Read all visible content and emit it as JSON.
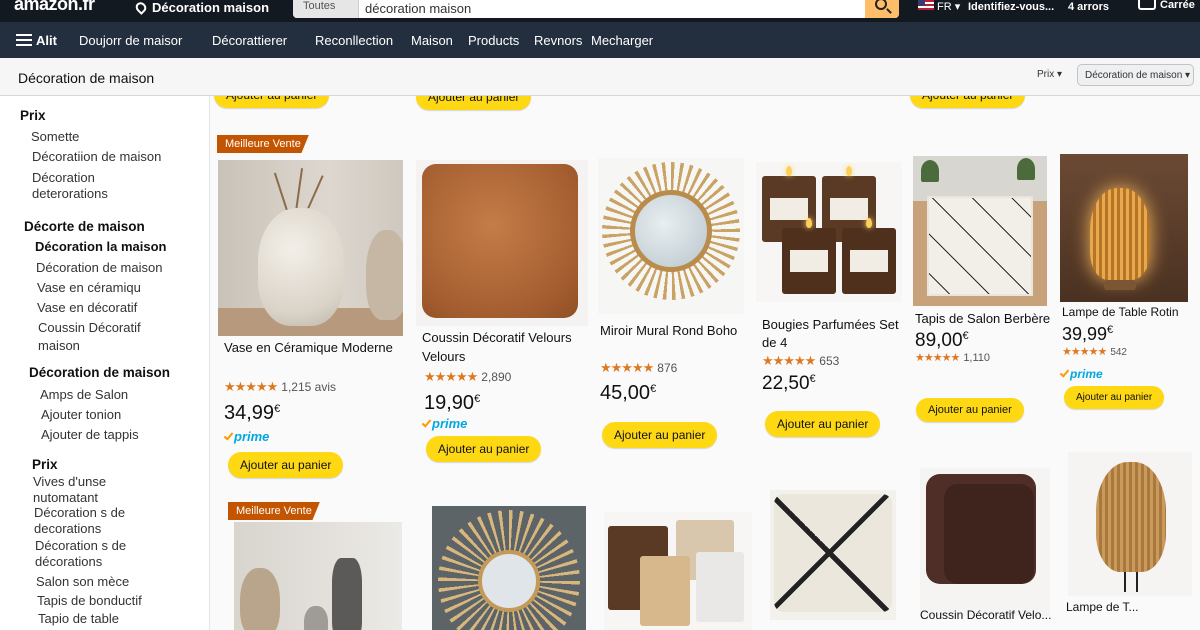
{
  "header": {
    "logo": "amazon.fr",
    "location": "Décoration maison",
    "search_category": "Toutes",
    "search_value": "décoration maison",
    "lang": "FR",
    "account": "Identifiez-vous...",
    "orders": "4 arrors",
    "cart": "Carrée"
  },
  "nav": {
    "all": "Alit",
    "items": [
      "Doujorr de maisor",
      "Décorattierer",
      "Reconllection",
      "Maison",
      "Products",
      "Revnors",
      "Mecharger"
    ]
  },
  "subheader": {
    "title": "Décoration de maison",
    "sort_label": "Prix",
    "sort_value": "Décoration de maison"
  },
  "sidebar": [
    {
      "text": "Prix",
      "style": "head"
    },
    {
      "text": "Somette",
      "style": "item"
    },
    {
      "text": "Décoratiion de maison",
      "style": "item"
    },
    {
      "text": "Décoration",
      "style": "item"
    },
    {
      "text": "deterorations",
      "style": "item"
    },
    {
      "text": "Décorte de maison",
      "style": "head"
    },
    {
      "text": "Décoration la maison",
      "style": "strong"
    },
    {
      "text": "Décoration de maison",
      "style": "item"
    },
    {
      "text": "Vase en céramiqu",
      "style": "item"
    },
    {
      "text": "Vase en décoratif",
      "style": "item"
    },
    {
      "text": "Coussin Décoratif",
      "style": "item"
    },
    {
      "text": "maison",
      "style": "item"
    },
    {
      "text": "Décoration de maison",
      "style": "head"
    },
    {
      "text": "Amps de Salon",
      "style": "item"
    },
    {
      "text": "Ajouter tonion",
      "style": "item"
    },
    {
      "text": "Ajouter de tappis",
      "style": "item"
    },
    {
      "text": "Prix",
      "style": "head"
    },
    {
      "text": "Vives d'unse",
      "style": "item"
    },
    {
      "text": "nutomatant",
      "style": "item"
    },
    {
      "text": "Décoration s de",
      "style": "item"
    },
    {
      "text": "decorations",
      "style": "item"
    },
    {
      "text": "Décoration s de",
      "style": "item"
    },
    {
      "text": "décorations",
      "style": "item"
    },
    {
      "text": "Salon son mèce",
      "style": "item"
    },
    {
      "text": "Tapis de bonductif",
      "style": "item"
    },
    {
      "text": "Tapio de table",
      "style": "item"
    }
  ],
  "add_to_cart": "Ajouter au panier",
  "bestseller": "Meilleure Vente",
  "prime": "prime",
  "products": [
    {
      "title": "Vase en Céramique Moderne",
      "stars": "★★★★★",
      "reviews": "1,215 avis",
      "price": "34,99",
      "currency": "€",
      "prime": true
    },
    {
      "title": "Coussin Décoratif Velours Velours",
      "stars": "★★★★★",
      "reviews": "2,890",
      "price": "19,90",
      "currency": "€",
      "prime": true
    },
    {
      "title": "Miroir Mural Rond Boho",
      "stars": "★★★★★",
      "reviews": "876",
      "price": "45,00",
      "currency": "€",
      "prime": false
    },
    {
      "title": "Bougies Parfumées Set de 4",
      "stars": "★★★★★",
      "reviews": "653",
      "price": "22,50",
      "currency": "€",
      "prime": false
    },
    {
      "title": "Tapis de Salon Berbère",
      "stars": "★★★★★",
      "reviews": "1,110",
      "price": "89,00",
      "currency": "€",
      "prime": false
    },
    {
      "title": "Lampe de Table Rotin",
      "stars": "★★★★★",
      "reviews": "542",
      "price": "39,99",
      "currency": "€",
      "prime": true
    }
  ],
  "row2_titles": [
    "Coussin Décoratif Velo...",
    "Lampe de T..."
  ],
  "colors": {
    "header": "#131921",
    "nav": "#232f3e",
    "cart_button": "#ffd814",
    "badge": "#c45500",
    "stars": "#de7921",
    "prime": "#00a8e1"
  }
}
